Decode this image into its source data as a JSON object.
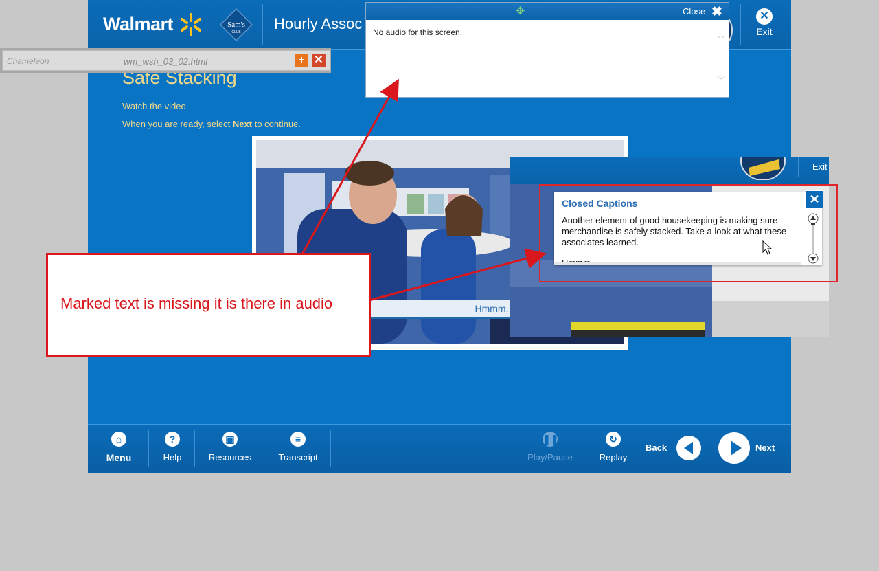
{
  "header": {
    "walmart": "Walmart",
    "sams_club": "Sam's",
    "sams_sub": "CLUB",
    "course_title": "Hourly Assoc",
    "exit": "Exit"
  },
  "content": {
    "title": "Safe Stacking",
    "line1": "Watch the video.",
    "line2_pre": "When you are ready, select ",
    "line2_bold": "Next",
    "line2_post": " to continue."
  },
  "video": {
    "caption": "Hmmm."
  },
  "footer": {
    "menu": "Menu",
    "help": "Help",
    "resources": "Resources",
    "transcript": "Transcript",
    "play_pause": "Play/Pause",
    "replay": "Replay",
    "back": "Back",
    "next": "Next"
  },
  "chameleon": {
    "logo": "Chameleon",
    "file": "wm_wsh_03_02.html"
  },
  "audio_popup": {
    "close": "Close",
    "text": "No audio for this screen."
  },
  "cc_inset": {
    "exit": "Exit",
    "title": "Closed Captions",
    "text": "Another element of good housekeeping is making sure merchandise is safely stacked.  Take a look at what these associates learned.",
    "cut_text": "Hmmm"
  },
  "annotation": {
    "text": "Marked text is missing it is there in audio"
  },
  "colors": {
    "brand_blue": "#0a74c4",
    "title_gold": "#f1d98a",
    "annotation_red": "#d9171d"
  }
}
